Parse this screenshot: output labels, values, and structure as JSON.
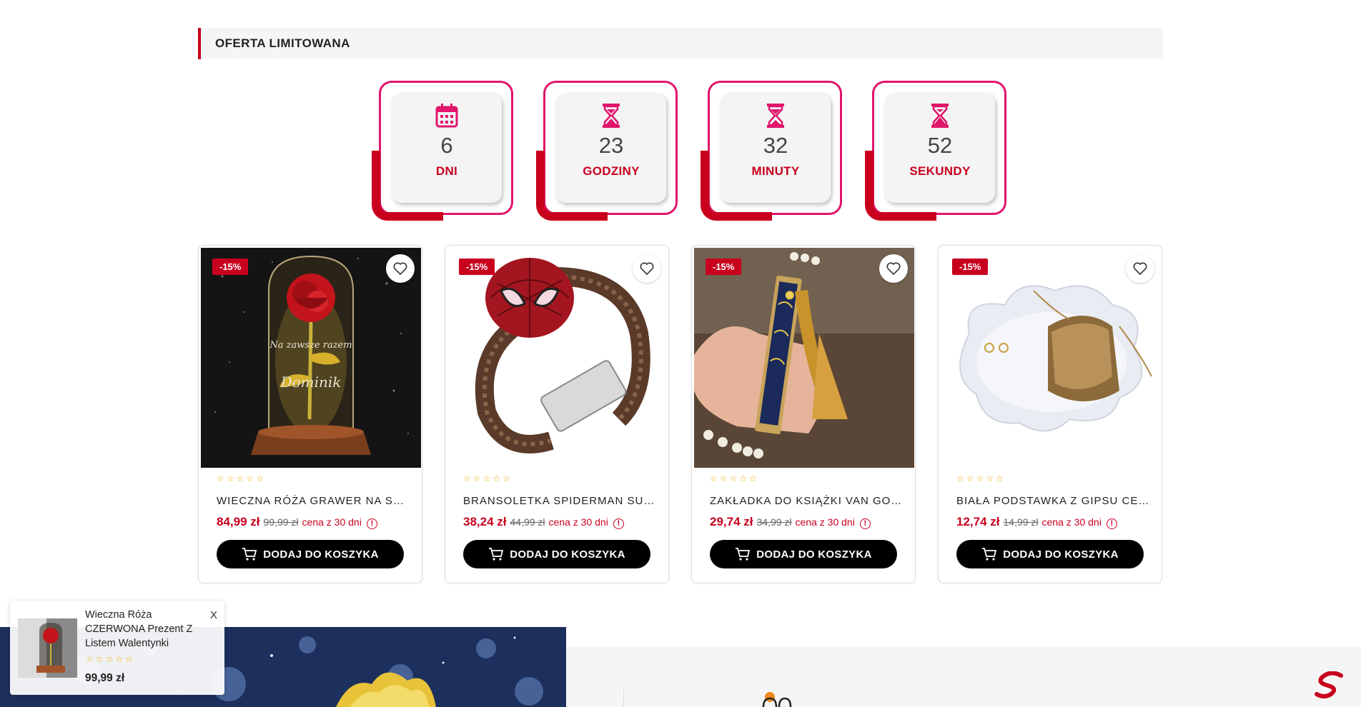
{
  "section": {
    "title": "OFERTA LIMITOWANA"
  },
  "countdown": [
    {
      "icon": "calendar-icon",
      "value": "6",
      "label": "DNI"
    },
    {
      "icon": "hourglass-icon",
      "value": "23",
      "label": "GODZINY"
    },
    {
      "icon": "hourglass-icon",
      "value": "32",
      "label": "MINUTY"
    },
    {
      "icon": "hourglass-icon",
      "value": "52",
      "label": "SEKUNDY"
    }
  ],
  "products": [
    {
      "badge": "-15%",
      "name": "WIECZNA RÓŻA GRAWER NA SZK...",
      "price": "84,99 zł",
      "old_price": "99,99 zł",
      "price_note": "cena z 30 dni",
      "button": "DODAJ DO KOSZYKA",
      "rating": "0/5"
    },
    {
      "badge": "-15%",
      "name": "BRANSOLETKA SPIDERMAN SUP...",
      "price": "38,24 zł",
      "old_price": "44,99 zł",
      "price_note": "cena z 30 dni",
      "button": "DODAJ DO KOSZYKA",
      "rating": "0/5"
    },
    {
      "badge": "-15%",
      "name": "ZAKŁADKA DO KSIĄŻKI VAN GOG...",
      "price": "29,74 zł",
      "old_price": "34,99 zł",
      "price_note": "cena z 30 dni",
      "button": "DODAJ DO KOSZYKA",
      "rating": "0/5"
    },
    {
      "badge": "-15%",
      "name": "BIAŁA PODSTAWKA Z GIPSU CER...",
      "price": "12,74 zł",
      "old_price": "14,99 zł",
      "price_note": "cena z 30 dni",
      "button": "DODAJ DO KOSZYKA",
      "rating": "0/5"
    }
  ],
  "popup": {
    "title": "Wieczna Róża CZERWONA Prezent Z Listem Walentynki",
    "price": "99,99 zł",
    "close": "X",
    "rating": "0/5"
  },
  "colors": {
    "accent": "#c8001e",
    "frame": "#e0156b",
    "button": "#000000"
  }
}
